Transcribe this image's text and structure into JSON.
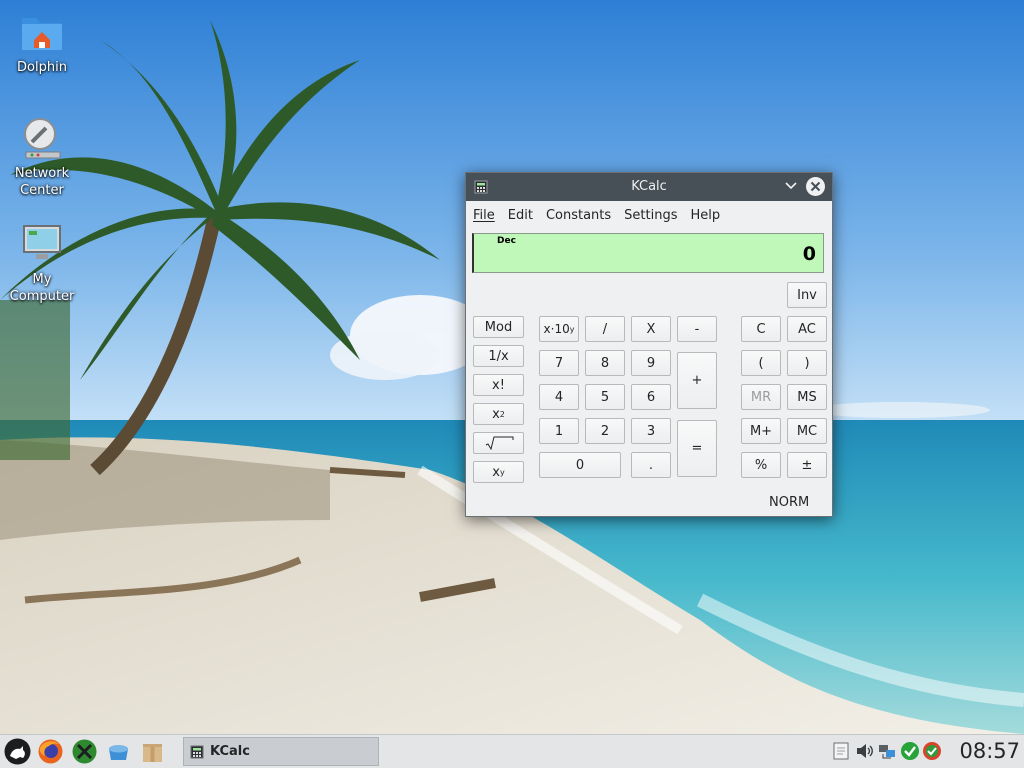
{
  "desktop": {
    "icons": [
      {
        "label": "Dolphin"
      },
      {
        "label": "Network Center"
      },
      {
        "label": "My Computer"
      }
    ]
  },
  "window": {
    "title": "KCalc",
    "menu": [
      "File",
      "Edit",
      "Constants",
      "Settings",
      "Help"
    ],
    "display": {
      "base": "Dec",
      "value": "0"
    },
    "buttons": {
      "inv": "Inv",
      "mod": "Mod",
      "recip": "1/x",
      "fact": "x!",
      "square": "x",
      "square_sup": "2",
      "xpowy": "x",
      "xpowy_sup": "y",
      "sci": "x·10",
      "sci_sup": "y",
      "div": "/",
      "mul": "X",
      "sub": "-",
      "add": "+",
      "eq": "=",
      "d7": "7",
      "d8": "8",
      "d9": "9",
      "d4": "4",
      "d5": "5",
      "d6": "6",
      "d1": "1",
      "d2": "2",
      "d3": "3",
      "d0": "0",
      "dot": ".",
      "clear": "C",
      "allclear": "AC",
      "lparen": "(",
      "rparen": ")",
      "mr": "MR",
      "ms": "MS",
      "mplus": "M+",
      "mc": "MC",
      "percent": "%",
      "plusminus": "±"
    },
    "mode": "NORM"
  },
  "taskbar": {
    "task_label": "KCalc",
    "clock": "08:57"
  }
}
